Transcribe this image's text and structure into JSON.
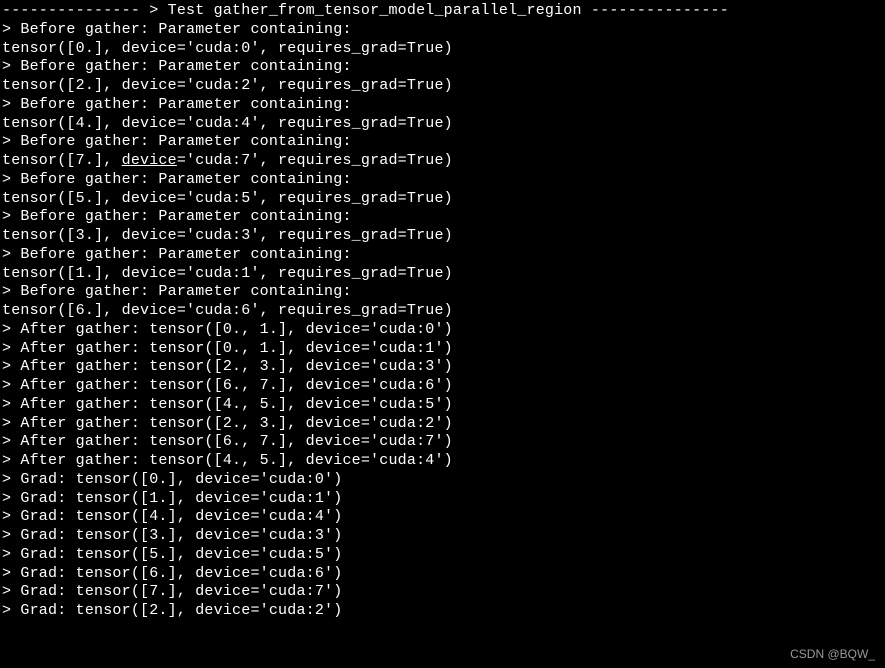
{
  "header": {
    "dashes_left": "---------------",
    "arrow": ">",
    "label": "Test gather_from_tensor_model_parallel_region",
    "dashes_right": "---------------"
  },
  "before_gather_label": "Before gather: Parameter containing:",
  "before": [
    {
      "val": "0.",
      "device": "cuda:0"
    },
    {
      "val": "2.",
      "device": "cuda:2"
    },
    {
      "val": "4.",
      "device": "cuda:4"
    },
    {
      "val": "7.",
      "device": "cuda:7",
      "underline_device_kw": true
    },
    {
      "val": "5.",
      "device": "cuda:5"
    },
    {
      "val": "3.",
      "device": "cuda:3"
    },
    {
      "val": "1.",
      "device": "cuda:1"
    },
    {
      "val": "6.",
      "device": "cuda:6"
    }
  ],
  "requires_grad": "requires_grad=True",
  "after_gather_prefix": "After gather:",
  "after": [
    {
      "v1": "0.",
      "v2": "1.",
      "device": "cuda:0"
    },
    {
      "v1": "0.",
      "v2": "1.",
      "device": "cuda:1"
    },
    {
      "v1": "2.",
      "v2": "3.",
      "device": "cuda:3"
    },
    {
      "v1": "6.",
      "v2": "7.",
      "device": "cuda:6"
    },
    {
      "v1": "4.",
      "v2": "5.",
      "device": "cuda:5"
    },
    {
      "v1": "2.",
      "v2": "3.",
      "device": "cuda:2"
    },
    {
      "v1": "6.",
      "v2": "7.",
      "device": "cuda:7"
    },
    {
      "v1": "4.",
      "v2": "5.",
      "device": "cuda:4"
    }
  ],
  "grad_prefix": "Grad:",
  "grads": [
    {
      "val": "0.",
      "device": "cuda:0"
    },
    {
      "val": "1.",
      "device": "cuda:1"
    },
    {
      "val": "4.",
      "device": "cuda:4"
    },
    {
      "val": "3.",
      "device": "cuda:3"
    },
    {
      "val": "5.",
      "device": "cuda:5"
    },
    {
      "val": "6.",
      "device": "cuda:6"
    },
    {
      "val": "7.",
      "device": "cuda:7"
    },
    {
      "val": "2.",
      "device": "cuda:2"
    }
  ],
  "watermark": "CSDN @BQW_"
}
